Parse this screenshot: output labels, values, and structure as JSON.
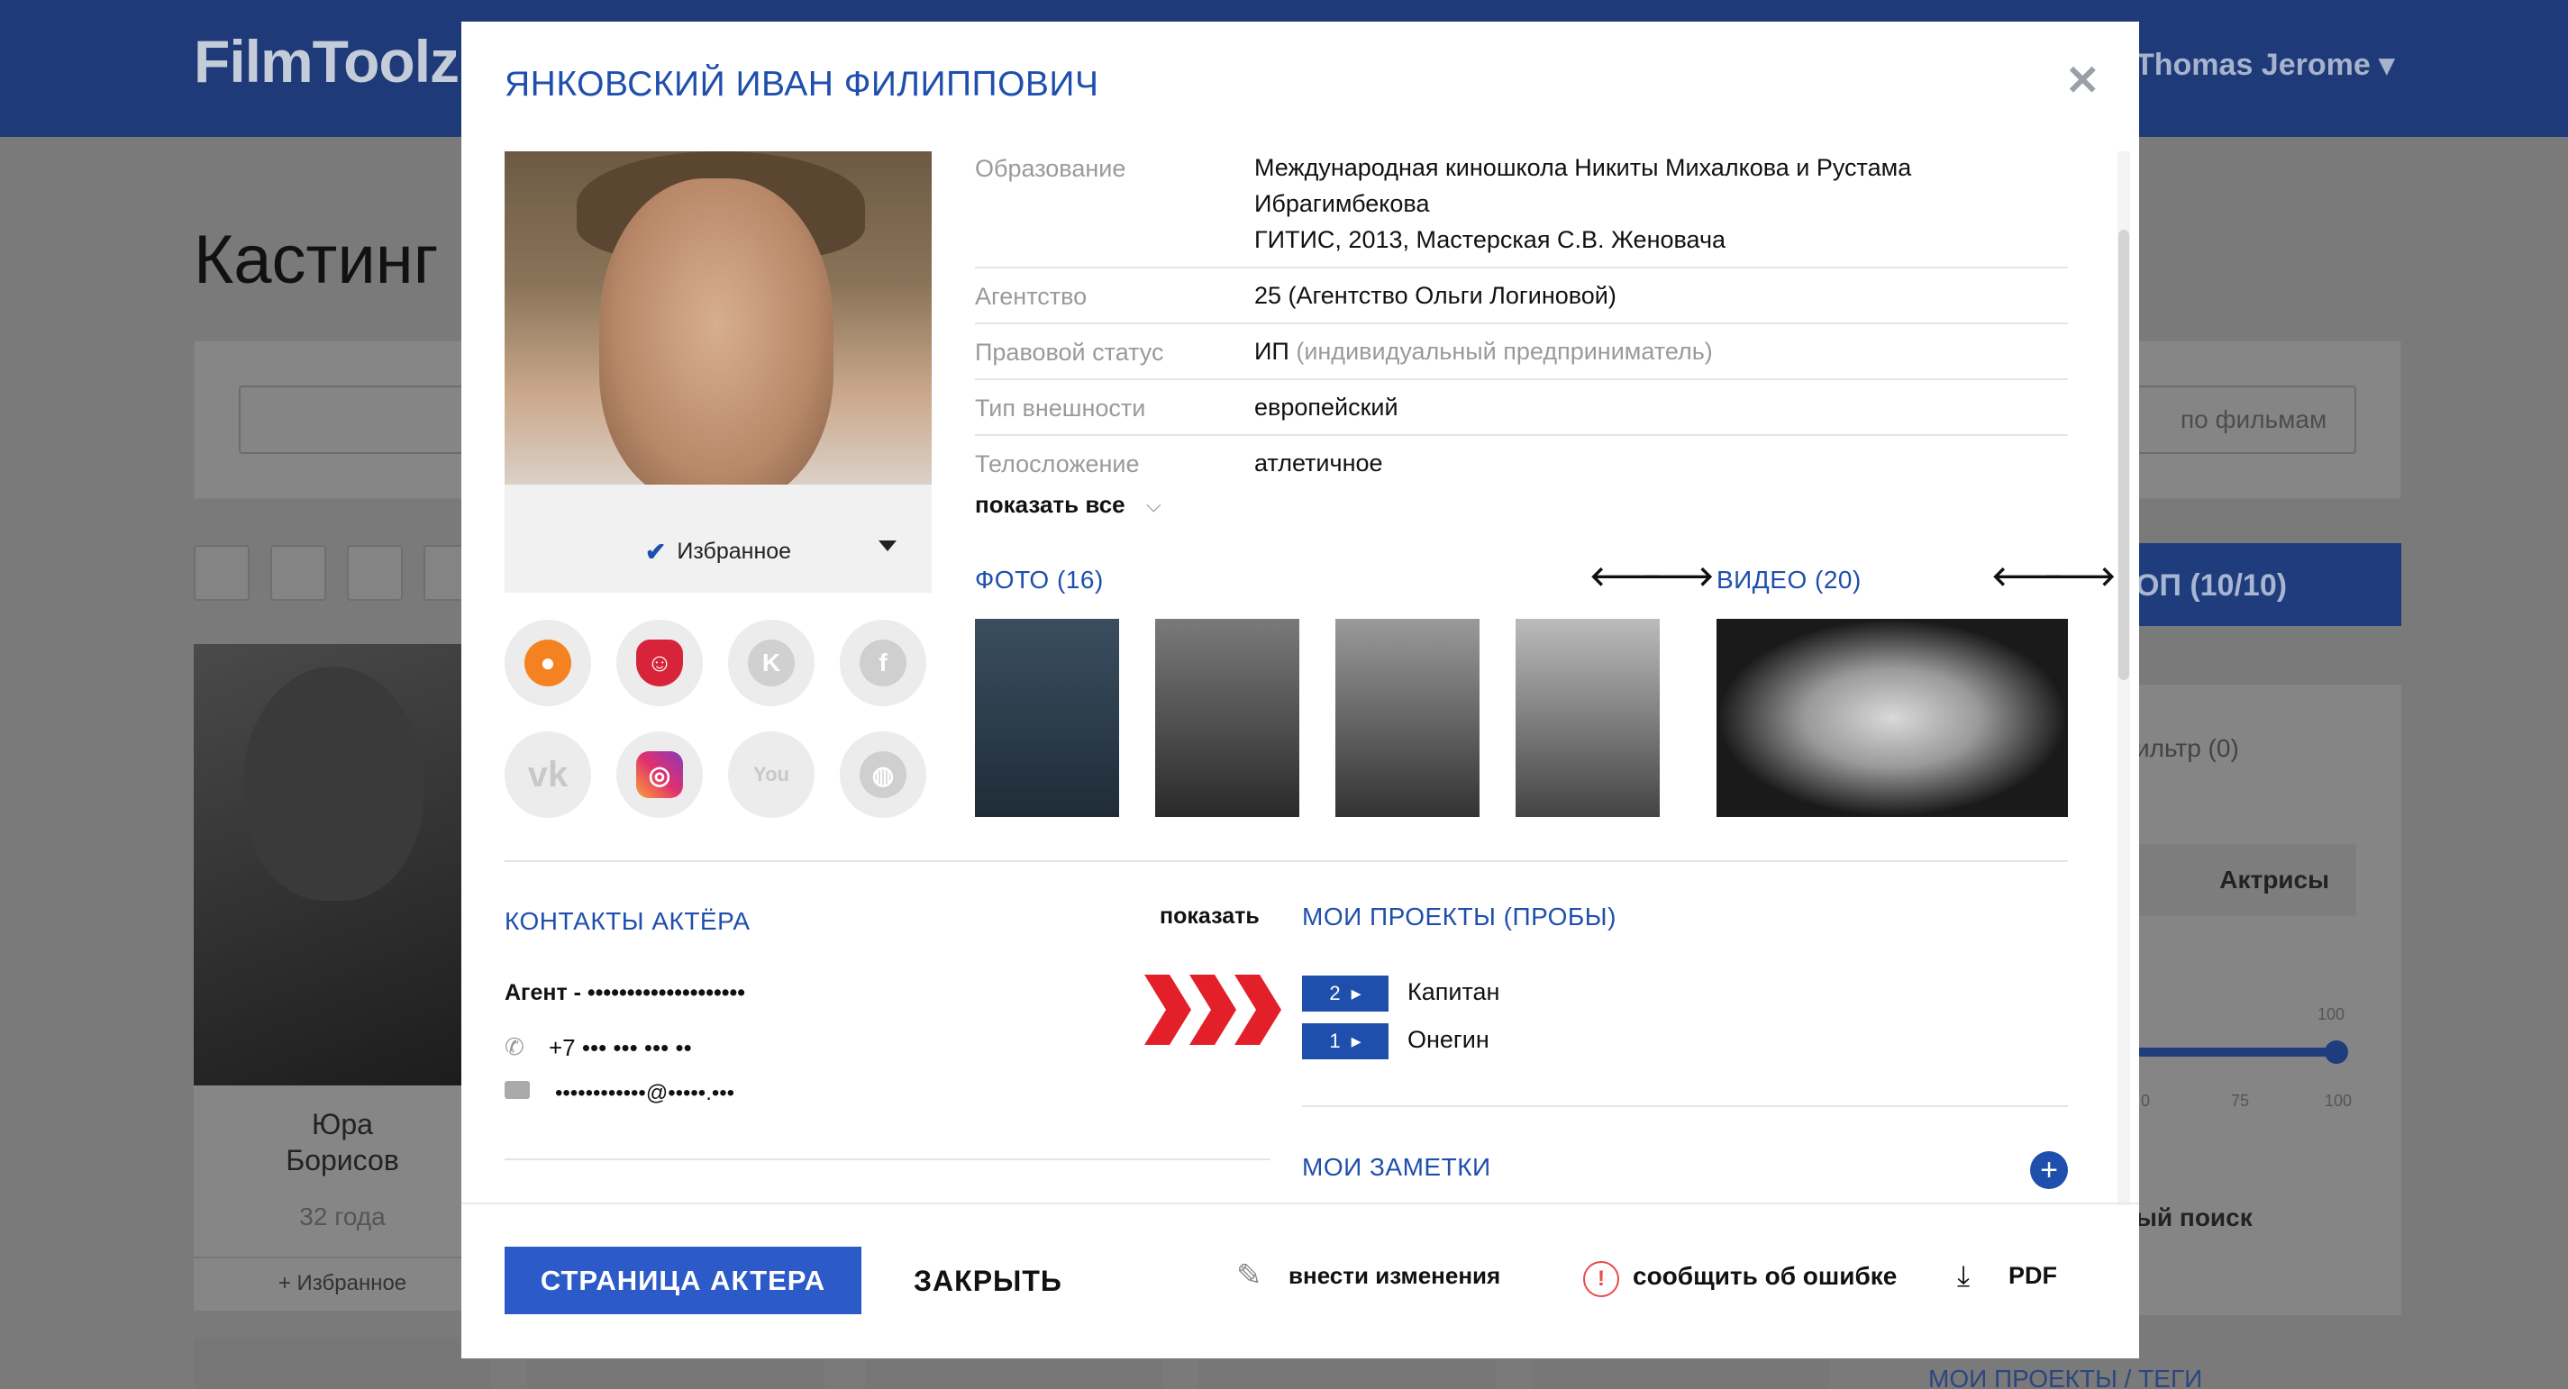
{
  "background": {
    "logo": "FilmToolz",
    "user_name": "Thomas Jerome",
    "page_title": "Кастинг",
    "search_films_label": "по фильмам",
    "blue_button": "ОП (10/10)",
    "filter_label": "ильтр (0)",
    "actresses_tab": "Актрисы",
    "slider_value": "100",
    "slider_ticks": [
      "0",
      "75",
      "100"
    ],
    "extended_search": "ый поиск",
    "projects_tags": "МОИ ПРОЕКТЫ / ТЕГИ",
    "actor_card": {
      "first_name": "Юра",
      "last_name": "Борисов",
      "age": "32 года",
      "fav": "Избранное"
    }
  },
  "modal": {
    "title": "ЯНКОВСКИЙ ИВАН ФИЛИППОВИЧ",
    "favorite_label": "Избранное",
    "info": [
      {
        "label": "Образование",
        "lines": [
          "Международная киношкола Никиты Михалкова и Рустама",
          "Ибрагимбекова",
          "ГИТИС, 2013, Мастерская С.В. Женовача"
        ]
      },
      {
        "label": "Агентство",
        "value": "25 (Агентство Ольги Логиновой)"
      },
      {
        "label": "Правовой статус",
        "value": "ИП",
        "value_extra": "(индивидуальный предприниматель)"
      },
      {
        "label": "Тип внешности",
        "value": "европейский"
      },
      {
        "label": "Телосложение",
        "value": "атлетичное"
      }
    ],
    "show_all": "показать все",
    "photos_title": "ФОТО (16)",
    "videos_title": "ВИДЕО (20)",
    "contacts_title": "КОНТАКТЫ АКТЁРА",
    "show_contacts": "показать",
    "agent": "Агент - ••••••••••••••••••••",
    "phone": "+7 ••• ••• ••• ••",
    "email": "••••••••••••@•••••.•••",
    "projects_title": "МОИ ПРОЕКТЫ (ПРОБЫ)",
    "projects": [
      {
        "count": "2",
        "name": "Капитан"
      },
      {
        "count": "1",
        "name": "Онегин"
      }
    ],
    "notes_title": "МОИ ЗАМЕТКИ",
    "footer": {
      "actor_page": "СТРАНИЦА АКТЕРА",
      "close": "ЗАКРЫТЬ",
      "edit": "внести изменения",
      "report": "сообщить об ошибке",
      "pdf": "PDF"
    },
    "social_icons": [
      "kinopoisk-icon",
      "theatre-icon",
      "kinoteatr-icon",
      "facebook-icon",
      "vk-icon",
      "instagram-icon",
      "youtube-icon",
      "globe-icon"
    ]
  }
}
